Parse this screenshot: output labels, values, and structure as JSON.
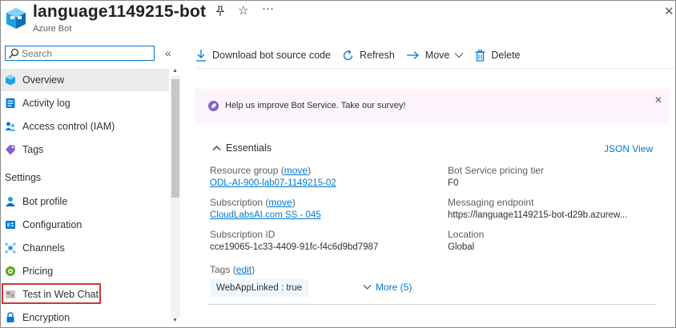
{
  "header": {
    "title": "language1149215-bot",
    "subtitle": "Azure Bot",
    "actions": {
      "pin_icon": "pin-icon",
      "favorite": "☆",
      "more": "···",
      "close": "✕"
    }
  },
  "sidebar": {
    "search_placeholder": "Search",
    "collapse_glyph": "«",
    "items_top": [
      {
        "label": "Overview",
        "icon": "bot-cube-icon",
        "active": true
      },
      {
        "label": "Activity log",
        "icon": "activity-log-icon"
      },
      {
        "label": "Access control (IAM)",
        "icon": "people-icon"
      },
      {
        "label": "Tags",
        "icon": "tag-icon"
      }
    ],
    "section_label": "Settings",
    "items_settings": [
      {
        "label": "Bot profile",
        "icon": "bot-profile-icon"
      },
      {
        "label": "Configuration",
        "icon": "configuration-icon"
      },
      {
        "label": "Channels",
        "icon": "channels-icon"
      },
      {
        "label": "Pricing",
        "icon": "pricing-icon"
      },
      {
        "label": "Test in Web Chat",
        "icon": "web-chat-icon",
        "highlighted": true
      },
      {
        "label": "Encryption",
        "icon": "lock-icon"
      }
    ]
  },
  "toolbar": {
    "download_label": "Download bot source code",
    "refresh_label": "Refresh",
    "move_label": "Move",
    "delete_label": "Delete"
  },
  "banner": {
    "text": "Help us improve Bot Service. Take our survey!",
    "close": "✕"
  },
  "essentials": {
    "heading": "Essentials",
    "json_view": "JSON View",
    "resource_group_label": "Resource group",
    "resource_group_action": "move",
    "resource_group_value": "ODL-AI-900-lab07-1149215-02",
    "subscription_label": "Subscription",
    "subscription_action": "move",
    "subscription_value": "CloudLabsAI.com SS - 045",
    "subscription_id_label": "Subscription ID",
    "subscription_id_value": "cce19065-1c33-4409-91fc-f4c6d9bd7987",
    "pricing_tier_label": "Bot Service pricing tier",
    "pricing_tier_value": "F0",
    "endpoint_label": "Messaging endpoint",
    "endpoint_value": "https://language1149215-bot-d29b.azurew...",
    "location_label": "Location",
    "location_value": "Global",
    "tags_label": "Tags",
    "tags_action": "edit",
    "tag_chip": "WebAppLinked : true",
    "more_tags": "More (5)"
  },
  "colors": {
    "accent": "#0078d4",
    "highlight": "#d13438",
    "banner_bg": "#fcf3fc",
    "selected_bg": "#edebe9"
  }
}
